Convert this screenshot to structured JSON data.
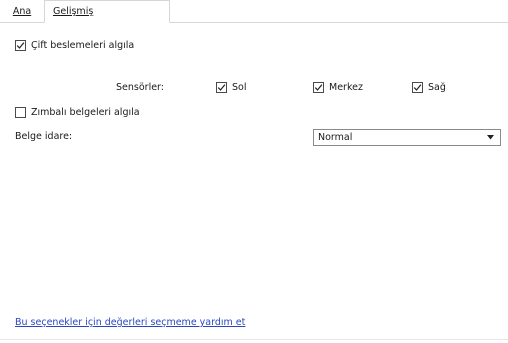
{
  "tabs": {
    "ana": "Ana",
    "gelismis": "Gelişmiş"
  },
  "double_feed": {
    "label": "Çift beslemeleri algıla",
    "checked": true
  },
  "sensors": {
    "label": "Sensörler:",
    "sol": {
      "label": "Sol",
      "checked": true
    },
    "merkez": {
      "label": "Merkez",
      "checked": true
    },
    "sag": {
      "label": "Sağ",
      "checked": true
    }
  },
  "staple": {
    "label": "Zımbalı belgeleri algıla",
    "checked": false
  },
  "doc_handling": {
    "label": "Belge idare:",
    "value": "Normal"
  },
  "help_link": "Bu seçenekler için değerleri seçmeme yardım et",
  "icons": {
    "check": "checkmark-icon",
    "dropdown": "chevron-down-icon"
  }
}
